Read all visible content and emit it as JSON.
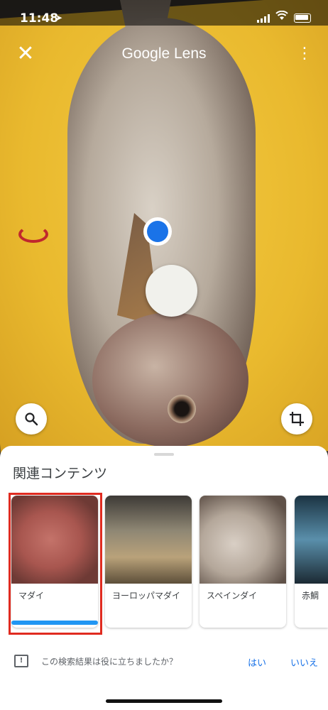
{
  "status_bar": {
    "time": "11:48"
  },
  "header": {
    "title": "Google Lens"
  },
  "sheet": {
    "title": "関連コンテンツ",
    "cards": [
      {
        "label": "マダイ"
      },
      {
        "label": "ヨーロッパマダイ"
      },
      {
        "label": "スペインダイ"
      },
      {
        "label": "赤鯛"
      }
    ],
    "feedback": {
      "question": "この検索結果は役に立ちましたか？",
      "yes": "はい",
      "no": "いいえ"
    }
  },
  "colors": {
    "accent": "#1a73e8",
    "selection": "#e02b20",
    "progress": "#2196f3"
  },
  "icons": [
    "close-icon",
    "more-vert-icon",
    "search-icon",
    "crop-icon",
    "feedback-icon",
    "location-icon",
    "wifi-icon",
    "battery-icon",
    "signal-icon"
  ]
}
